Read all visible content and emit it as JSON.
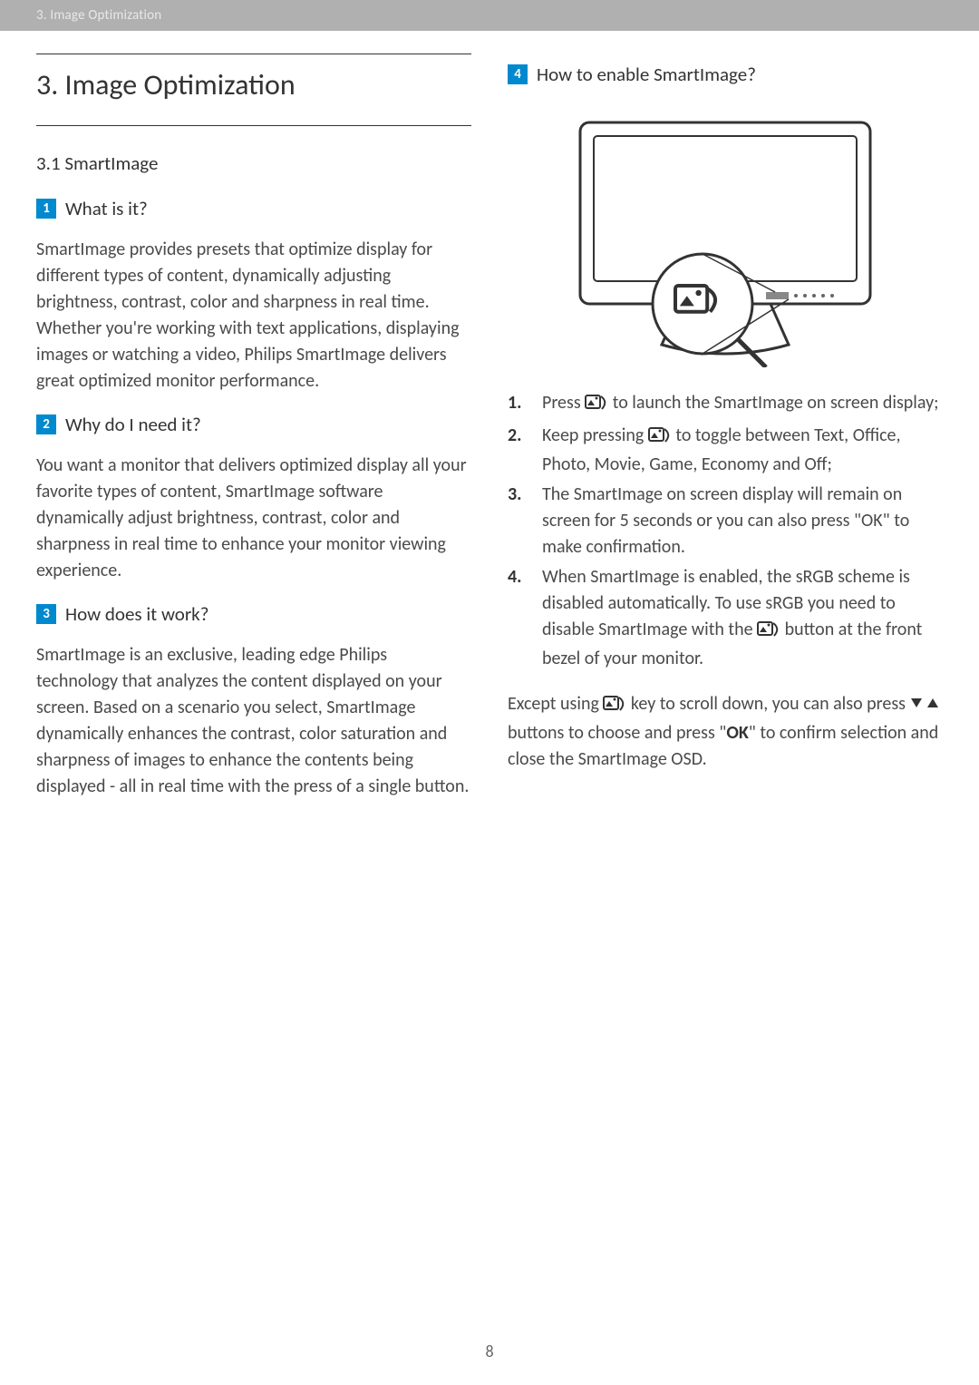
{
  "header": {
    "breadcrumb": "3. Image Optimization"
  },
  "left": {
    "title": "3.  Image Optimization",
    "section": "3.1 SmartImage",
    "q1": {
      "num": "1",
      "text": "What is it?"
    },
    "p1": "SmartImage provides presets that optimize display for different types of content, dynamically adjusting brightness, contrast, color and sharpness in real time. Whether you're working with text applications, displaying images or watching a video, Philips SmartImage delivers great optimized monitor performance.",
    "q2": {
      "num": "2",
      "text": "Why do I need it?"
    },
    "p2": "You want a monitor that delivers optimized display all your favorite types of content, SmartImage software dynamically adjust brightness, contrast, color and sharpness in real time to enhance your monitor viewing experience.",
    "q3": {
      "num": "3",
      "text": "How does it work?"
    },
    "p3": "SmartImage is an exclusive, leading edge Philips technology that analyzes the content displayed on your screen. Based on a scenario you select, SmartImage dynamically enhances the contrast, color saturation and sharpness of images to enhance the contents being displayed - all in real time with the press of a single button."
  },
  "right": {
    "q4": {
      "num": "4",
      "text": "How to enable SmartImage?"
    },
    "steps": [
      {
        "num": "1.",
        "pre": "Press ",
        "post": " to launch the SmartImage on screen display;"
      },
      {
        "num": "2.",
        "pre": "Keep pressing ",
        "post": " to toggle between Text, Office, Photo, Movie, Game, Economy and Off;"
      },
      {
        "num": "3.",
        "text": "The SmartImage on screen display will remain on screen for 5 seconds or you can also press \"OK\" to make confirmation."
      },
      {
        "num": "4.",
        "pre": "When SmartImage is enabled, the sRGB scheme is disabled automatically. To use sRGB you need to disable SmartImage with the ",
        "post": " button at the front bezel of your monitor."
      }
    ],
    "closing": {
      "t1": "Except using ",
      "t2": " key to scroll down, you can also press ",
      "t3": " buttons to choose and press \"",
      "ok": "OK",
      "t4": "\" to confirm selection and close the SmartImage OSD."
    }
  },
  "page": "8"
}
